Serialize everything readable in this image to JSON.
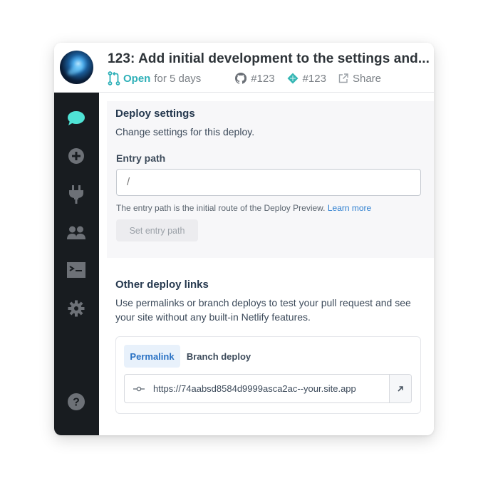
{
  "header": {
    "title": "123: Add initial development to the settings and...",
    "status": "Open",
    "status_suffix": "for 5 days",
    "github_ref": "#123",
    "deploy_ref": "#123",
    "share_label": "Share"
  },
  "sidebar": {
    "items": [
      {
        "icon": "comment-icon",
        "active": true
      },
      {
        "icon": "plus-circle-icon"
      },
      {
        "icon": "plug-icon"
      },
      {
        "icon": "users-icon"
      },
      {
        "icon": "terminal-icon"
      },
      {
        "icon": "gear-icon"
      },
      {
        "icon": "help-icon"
      }
    ]
  },
  "deploy_settings": {
    "title": "Deploy settings",
    "description": "Change settings for this deploy.",
    "entry_path_label": "Entry path",
    "entry_path_placeholder": "/",
    "help_text": "The entry path is the initial route of the Deploy Preview.",
    "learn_more": "Learn more",
    "set_button": "Set entry path"
  },
  "other_links": {
    "title": "Other deploy links",
    "description_line1": "Use permalinks or branch deploys to test your pull request and see",
    "description_line2": "your site without any built-in Netlify features.",
    "tabs": [
      "Permalink",
      "Branch deploy"
    ],
    "active_tab": "Permalink",
    "url": "https://74aabsd8584d9999asca2ac--your.site.app"
  },
  "colors": {
    "accent": "#2fb0b8",
    "link": "#2e7fd0",
    "sidebar_bg": "#181c20",
    "active_icon": "#4fe3d5"
  }
}
